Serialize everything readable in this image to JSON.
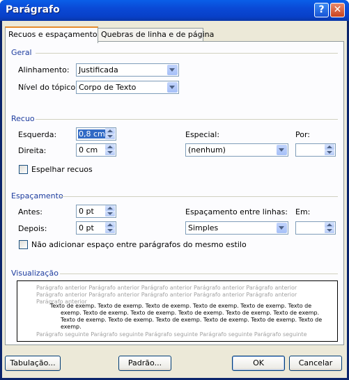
{
  "window": {
    "title": "Parágrafo",
    "help_glyph": "?",
    "close_glyph": "✕"
  },
  "tabs": [
    {
      "label": "Recuos e espaçamento"
    },
    {
      "label": "Quebras de linha e de página"
    }
  ],
  "geral": {
    "section_label": "Geral",
    "alinhamento_label": "Alinhamento:",
    "alinhamento_value": "Justificada",
    "nivel_label": "Nível do tópico:",
    "nivel_value": "Corpo de Texto"
  },
  "recuo": {
    "section_label": "Recuo",
    "esquerda_label": "Esquerda:",
    "esquerda_value": "0,8 cm",
    "direita_label": "Direita:",
    "direita_value": "0 cm",
    "especial_label": "Especial:",
    "especial_value": "(nenhum)",
    "por_label": "Por:",
    "por_value": "",
    "espelhar_label": "Espelhar recuos",
    "espelhar_checked": false
  },
  "espacamento": {
    "section_label": "Espaçamento",
    "antes_label": "Antes:",
    "antes_value": "0 pt",
    "depois_label": "Depois:",
    "depois_value": "0 pt",
    "entre_linhas_label": "Espaçamento entre linhas:",
    "entre_linhas_value": "Simples",
    "em_label": "Em:",
    "em_value": "",
    "nao_adicionar_label": "Não adicionar espaço entre parágrafos do mesmo estilo",
    "nao_adicionar_checked": false
  },
  "visualizacao": {
    "section_label": "Visualização",
    "previous": "Parágrafo anterior Parágrafo anterior Parágrafo anterior Parágrafo anterior Parágrafo anterior Parágrafo anterior Parágrafo anterior Parágrafo anterior Parágrafo anterior Parágrafo anterior Parágrafo anterior",
    "sample": "Texto de exemp. Texto de exemp. Texto de exemp. Texto de exemp. Texto de exemp. Texto de exemp. Texto de exemp. Texto de exemp. Texto de exemp. Texto de exemp. Texto de exemp. Texto de exemp. Texto de exemp. Texto de exemp. Texto de exemp. Texto de exemp. Texto de exemp.",
    "next": "Parágrafo seguinte Parágrafo seguinte Parágrafo seguinte Parágrafo seguinte Parágrafo seguinte"
  },
  "buttons": {
    "tabulacao": "Tabulação...",
    "padrao": "Padrão...",
    "ok": "OK",
    "cancelar": "Cancelar"
  },
  "colors": {
    "title_bar": "#0A49D6",
    "section_label": "#1D3C9E",
    "dialog_bg": "#ECE9D8"
  }
}
